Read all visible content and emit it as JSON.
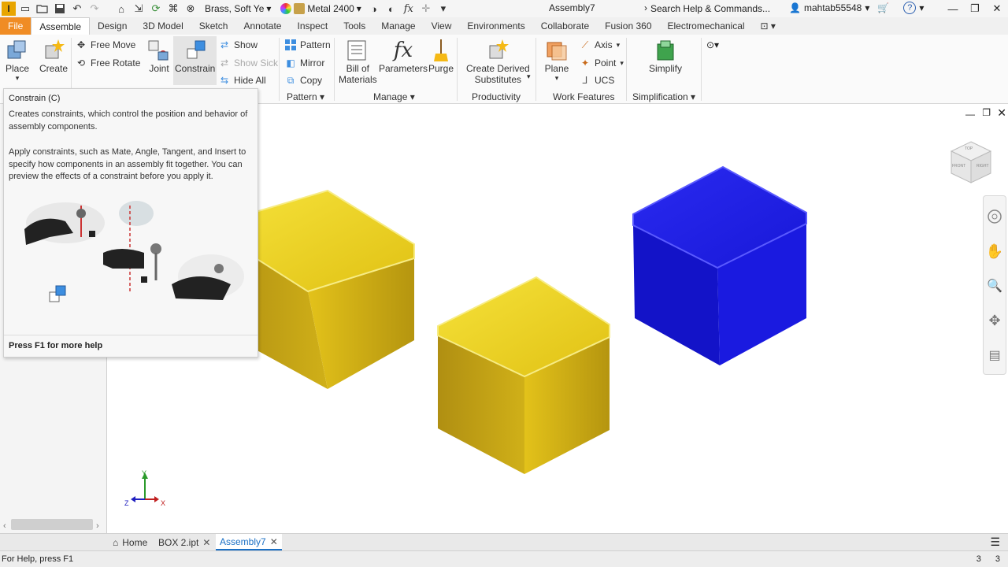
{
  "titlebar": {
    "app_logo": "I",
    "material": "Brass, Soft Ye",
    "appearance": "Metal 2400",
    "document_title": "Assembly7",
    "search_placeholder": "Search Help & Commands...",
    "username": "mahtab55548",
    "icons": [
      "new-file-icon",
      "open-icon",
      "save-icon",
      "undo-icon",
      "redo-icon",
      "home-icon",
      "select-icon",
      "update-icon",
      "visibility-icon",
      "material-icon",
      "appearance-icon",
      "parameters-icon",
      "add-icon"
    ]
  },
  "tabs": [
    "File",
    "Assemble",
    "Design",
    "3D Model",
    "Sketch",
    "Annotate",
    "Inspect",
    "Tools",
    "Manage",
    "View",
    "Environments",
    "Collaborate",
    "Fusion 360",
    "Electromechanical"
  ],
  "active_tab": "Assemble",
  "ribbon": {
    "place": "Place",
    "create": "Create",
    "free_move": "Free Move",
    "free_rotate": "Free Rotate",
    "joint": "Joint",
    "constrain": "Constrain",
    "show": "Show",
    "show_sick": "Show Sick",
    "hide_all": "Hide All",
    "pattern": "Pattern",
    "mirror": "Mirror",
    "copy": "Copy",
    "bill_of_materials_1": "Bill of",
    "bill_of_materials_2": "Materials",
    "parameters": "Parameters",
    "purge": "Purge",
    "create_derived_1": "Create Derived",
    "create_derived_2": "Substitutes",
    "plane": "Plane",
    "axis": "Axis",
    "point": "Point",
    "ucs": "UCS",
    "simplify": "Simplify",
    "groups": {
      "pattern": "Pattern",
      "manage": "Manage",
      "productivity": "Productivity",
      "work_features": "Work Features",
      "simplification": "Simplification"
    }
  },
  "tooltip": {
    "title": "Constrain (C)",
    "description": "Creates constraints, which control the position and behavior of assembly components.",
    "body": "Apply constraints, such as Mate, Angle, Tangent, and Insert to specify how components in an assembly fit together. You can preview the effects of a constraint before you apply it.",
    "footer": "Press F1 for more help"
  },
  "viewcube": {
    "top": "TOP",
    "front": "FRONT",
    "right": "RIGHT"
  },
  "triad": {
    "x": "X",
    "y": "Y",
    "z": "Z"
  },
  "colors": {
    "accent": "#f08c24",
    "cube_yellow": "#e3c21a",
    "cube_blue": "#1a1adf",
    "active_tab_text": "#1a6fc4"
  },
  "doc_tabs": [
    {
      "label": "Home"
    },
    {
      "label": "BOX 2.ipt"
    },
    {
      "label": "Assembly7"
    }
  ],
  "status": {
    "help": "For Help, press F1",
    "count_1": "3",
    "count_2": "3"
  }
}
